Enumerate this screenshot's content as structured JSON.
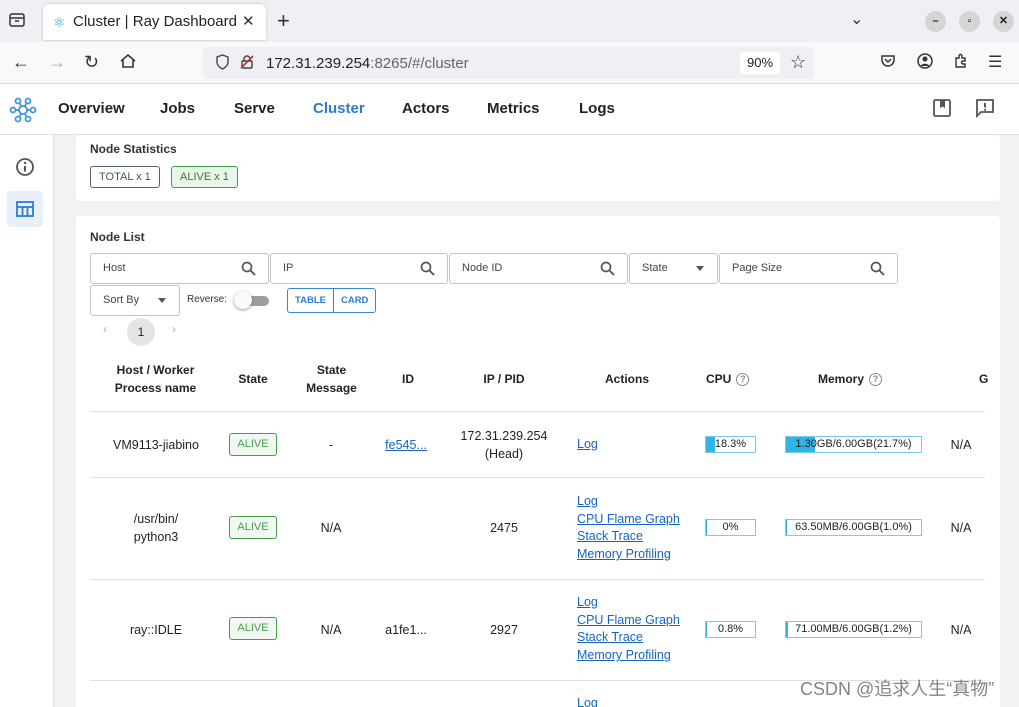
{
  "browser": {
    "tab_title": "Cluster | Ray Dashboard",
    "url_host": "172.31.239.254",
    "url_rest": ":8265/#/cluster",
    "zoom": "90%"
  },
  "app": {
    "nav": [
      "Overview",
      "Jobs",
      "Serve",
      "Cluster",
      "Actors",
      "Metrics",
      "Logs"
    ],
    "active_nav": "Cluster",
    "accent": "#2a7dd0"
  },
  "stats": {
    "title": "Node Statistics",
    "total": "TOTAL x 1",
    "alive": "ALIVE x 1"
  },
  "node_list": {
    "title": "Node List",
    "filters": {
      "host": "Host",
      "ip": "IP",
      "node_id": "Node ID",
      "state": "State",
      "page_size": "Page Size",
      "sort_by": "Sort By",
      "reverse": "Reverse:",
      "reverse_on": false,
      "table": "TABLE",
      "card": "CARD"
    },
    "page": "1",
    "columns": {
      "host": "Host / Worker Process name",
      "state": "State",
      "state_message": "State Message",
      "id": "ID",
      "ip_pid": "IP / PID",
      "actions": "Actions",
      "cpu": "CPU",
      "memory": "Memory",
      "gpu_partial": "G"
    },
    "rows": [
      {
        "host": "VM9113-jiabino",
        "state": "ALIVE",
        "state_message": "-",
        "id": "fe545...",
        "ip_pid": "172.31.239.254 (Head)",
        "actions": [
          "Log"
        ],
        "cpu": "18.3%",
        "cpu_pct": 18.3,
        "memory": "1.30GB/6.00GB(21.7%)",
        "mem_pct": 21.7,
        "gpu": "N/A"
      },
      {
        "host": "/usr/bin/ python3",
        "state": "ALIVE",
        "state_message": "N/A",
        "id": "",
        "ip_pid": "2475",
        "actions": [
          "Log",
          "CPU Flame Graph",
          "Stack Trace",
          "Memory Profiling"
        ],
        "cpu": "0%",
        "cpu_pct": 0,
        "memory": "63.50MB/6.00GB(1.0%)",
        "mem_pct": 1.0,
        "gpu": "N/A"
      },
      {
        "host": "ray::IDLE",
        "state": "ALIVE",
        "state_message": "N/A",
        "id": "a1fe1...",
        "ip_pid": "2927",
        "actions": [
          "Log",
          "CPU Flame Graph",
          "Stack Trace",
          "Memory Profiling"
        ],
        "cpu": "0.8%",
        "cpu_pct": 0.8,
        "memory": "71.00MB/6.00GB(1.2%)",
        "mem_pct": 1.2,
        "gpu": "N/A"
      },
      {
        "actions": [
          "Log"
        ]
      }
    ]
  },
  "watermark": "CSDN @追求人生“真物”"
}
